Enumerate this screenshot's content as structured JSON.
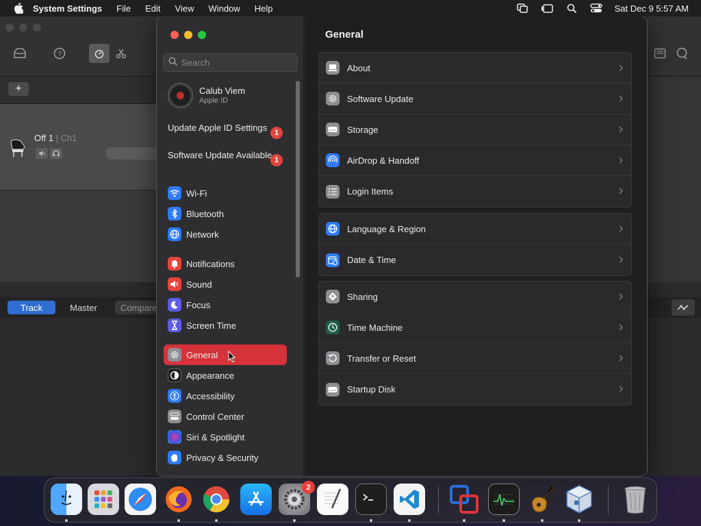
{
  "menubar": {
    "app_name": "System Settings",
    "menus": [
      "File",
      "Edit",
      "View",
      "Window",
      "Help"
    ],
    "datetime": "Sat Dec 9  5:57 AM"
  },
  "background_app": {
    "track_name": "Off 1",
    "track_channel": "| Ch1",
    "tabs": [
      "Track",
      "Master",
      "Compare"
    ]
  },
  "sidebar": {
    "search_placeholder": "Search",
    "profile": {
      "name": "Calub Viem",
      "subtitle": "Apple ID"
    },
    "notices": [
      {
        "label": "Update Apple ID Settings",
        "badge": "1"
      },
      {
        "label": "Software Update Available",
        "badge": "1"
      }
    ],
    "items": [
      {
        "label": "Wi-Fi",
        "icon": "wifi-icon",
        "color": "#2f7bf5"
      },
      {
        "label": "Bluetooth",
        "icon": "bluetooth-icon",
        "color": "#2f7bf5"
      },
      {
        "label": "Network",
        "icon": "globe-icon",
        "color": "#2f7bf5"
      },
      {
        "label": "Notifications",
        "icon": "bell-icon",
        "color": "#e5453d"
      },
      {
        "label": "Sound",
        "icon": "speaker-icon",
        "color": "#e5453d"
      },
      {
        "label": "Focus",
        "icon": "moon-icon",
        "color": "#5e5ce6"
      },
      {
        "label": "Screen Time",
        "icon": "hourglass-icon",
        "color": "#5e5ce6"
      },
      {
        "label": "General",
        "icon": "gear-icon",
        "color": "#8e8e93",
        "selected": true
      },
      {
        "label": "Appearance",
        "icon": "appearance-icon",
        "color": "#1c1c1e"
      },
      {
        "label": "Accessibility",
        "icon": "accessibility-icon",
        "color": "#2f7bf5"
      },
      {
        "label": "Control Center",
        "icon": "control-center-icon",
        "color": "#8e8e93"
      },
      {
        "label": "Siri & Spotlight",
        "icon": "siri-icon",
        "color": "#6c3ec9"
      },
      {
        "label": "Privacy & Security",
        "icon": "hand-icon",
        "color": "#2f7bf5"
      }
    ]
  },
  "main": {
    "title": "General",
    "groups": [
      [
        {
          "label": "About",
          "icon": "laptop-icon",
          "color": "#8e8e93"
        },
        {
          "label": "Software Update",
          "icon": "gear-icon",
          "color": "#8e8e93"
        },
        {
          "label": "Storage",
          "icon": "drive-icon",
          "color": "#8e8e93"
        },
        {
          "label": "AirDrop & Handoff",
          "icon": "airdrop-icon",
          "color": "#2f7bf5"
        },
        {
          "label": "Login Items",
          "icon": "list-icon",
          "color": "#8e8e93"
        }
      ],
      [
        {
          "label": "Language & Region",
          "icon": "globe-icon",
          "color": "#2f7bf5"
        },
        {
          "label": "Date & Time",
          "icon": "calendar-clock-icon",
          "color": "#2f7bf5"
        }
      ],
      [
        {
          "label": "Sharing",
          "icon": "sharing-icon",
          "color": "#8e8e93"
        },
        {
          "label": "Time Machine",
          "icon": "time-machine-icon",
          "color": "#1f5f4a"
        },
        {
          "label": "Transfer or Reset",
          "icon": "reset-icon",
          "color": "#8e8e93"
        },
        {
          "label": "Startup Disk",
          "icon": "drive-icon",
          "color": "#8e8e93"
        }
      ]
    ]
  },
  "dock": {
    "apps": [
      {
        "name": "Finder",
        "icon": "finder-icon",
        "color": "#3a8ff0"
      },
      {
        "name": "Launchpad",
        "icon": "launchpad-icon",
        "color": "#c9c9d0"
      },
      {
        "name": "Safari",
        "icon": "safari-icon",
        "color": "#2f8df2"
      },
      {
        "name": "Firefox",
        "icon": "firefox-icon",
        "color": "#f06a1e"
      },
      {
        "name": "Chrome",
        "icon": "chrome-icon",
        "color": "#f2f2f2"
      },
      {
        "name": "App Store",
        "icon": "app-store-icon",
        "color": "#1a8cf5"
      },
      {
        "name": "System Settings",
        "icon": "settings-icon",
        "color": "#8e8e93",
        "badge": "2"
      },
      {
        "name": "TextEdit",
        "icon": "textedit-icon",
        "color": "#f3f3f3"
      },
      {
        "name": "Terminal",
        "icon": "terminal-icon",
        "color": "#1e1e1e"
      },
      {
        "name": "VS Code",
        "icon": "vscode-icon",
        "color": "#f4f4f4"
      },
      {
        "name": "Parallels",
        "icon": "parallels-icon",
        "color": "#2a6fd6"
      },
      {
        "name": "Activity Monitor",
        "icon": "activity-monitor-icon",
        "color": "#2a2a2a"
      },
      {
        "name": "GarageBand",
        "icon": "garageband-icon",
        "color": "#c8862a"
      },
      {
        "name": "VirtualBox",
        "icon": "virtualbox-icon",
        "color": "#3b6ab3"
      },
      {
        "name": "Trash",
        "icon": "trash-icon",
        "color": "#8a8a8c"
      }
    ]
  }
}
